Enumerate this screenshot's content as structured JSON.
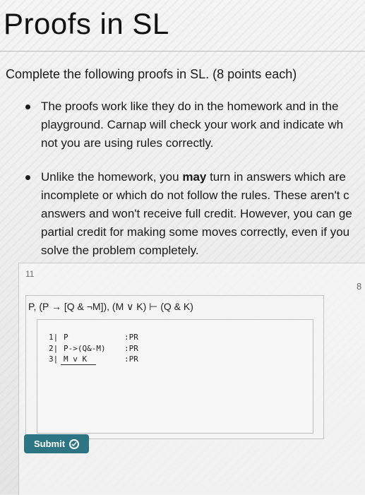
{
  "page": {
    "title": "Proofs in SL",
    "subtitle": "Complete the following proofs in SL. (8 points each)"
  },
  "bullets": [
    {
      "lines": [
        "The proofs work like they do in the homework and in the",
        "playground. Carnap will check your work and indicate wh",
        "not you are using rules correctly."
      ]
    },
    {
      "lines": [
        "Unlike the homework, you may turn in answers which are",
        "incomplete or which do not follow the rules. These aren't c",
        "answers and won't receive full credit. However, you can ge",
        "partial credit for making some moves correctly, even if you",
        "solve the problem completely."
      ],
      "bold_word": "may"
    }
  ],
  "question": {
    "number": "11",
    "points": "8",
    "statement": "P, (P → [Q & ¬M]), (M ∨ K) ⊢ (Q & K)",
    "proof_lines": [
      {
        "num": "1|",
        "formula": "P",
        "just": ":PR"
      },
      {
        "num": "2|",
        "formula": "P->(Q&-M)",
        "just": ":PR"
      },
      {
        "num": "3|",
        "formula": "M v K",
        "just": ":PR"
      }
    ],
    "submit_label": "Submit"
  },
  "colors": {
    "submit_bg": "#2d7582"
  },
  "icons": {
    "submit_icon": "check-circle-icon"
  }
}
